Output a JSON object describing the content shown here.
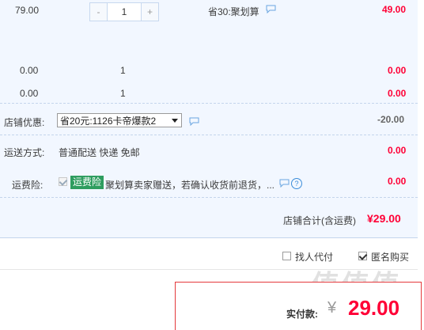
{
  "item_row": {
    "price": "79.00",
    "qty_minus": "-",
    "qty_value": "1",
    "qty_plus": "+",
    "discount": "省30:聚划算",
    "subtotal": "49.00"
  },
  "gift_rows": [
    {
      "price": "0.00",
      "qty": "1",
      "subtotal": "0.00"
    },
    {
      "price": "0.00",
      "qty": "1",
      "subtotal": "0.00"
    }
  ],
  "shop_discount": {
    "label": "店铺优惠:",
    "selected": "省20元:1126卡帝爆款2",
    "amount": "-20.00"
  },
  "shipping": {
    "label": "运送方式:",
    "value": "普通配送 快递 免邮",
    "amount": "0.00"
  },
  "insurance": {
    "label": "运费险:",
    "badge": "运费险",
    "text": "聚划算卖家赠送，若确认收货前退货，...",
    "amount": "0.00"
  },
  "shop_total": {
    "label": "店铺合计(含运费)",
    "amount": "¥29.00"
  },
  "options": {
    "proxy_pay": "找人代付",
    "anonymous": "匿名购买"
  },
  "payment": {
    "label": "实付款:",
    "currency": "¥",
    "amount": "29.00"
  },
  "watermark": "值值值",
  "colors": {
    "accent": "#ff0036",
    "panel_bg": "#f2f7ff",
    "badge": "#2e9d5f"
  }
}
